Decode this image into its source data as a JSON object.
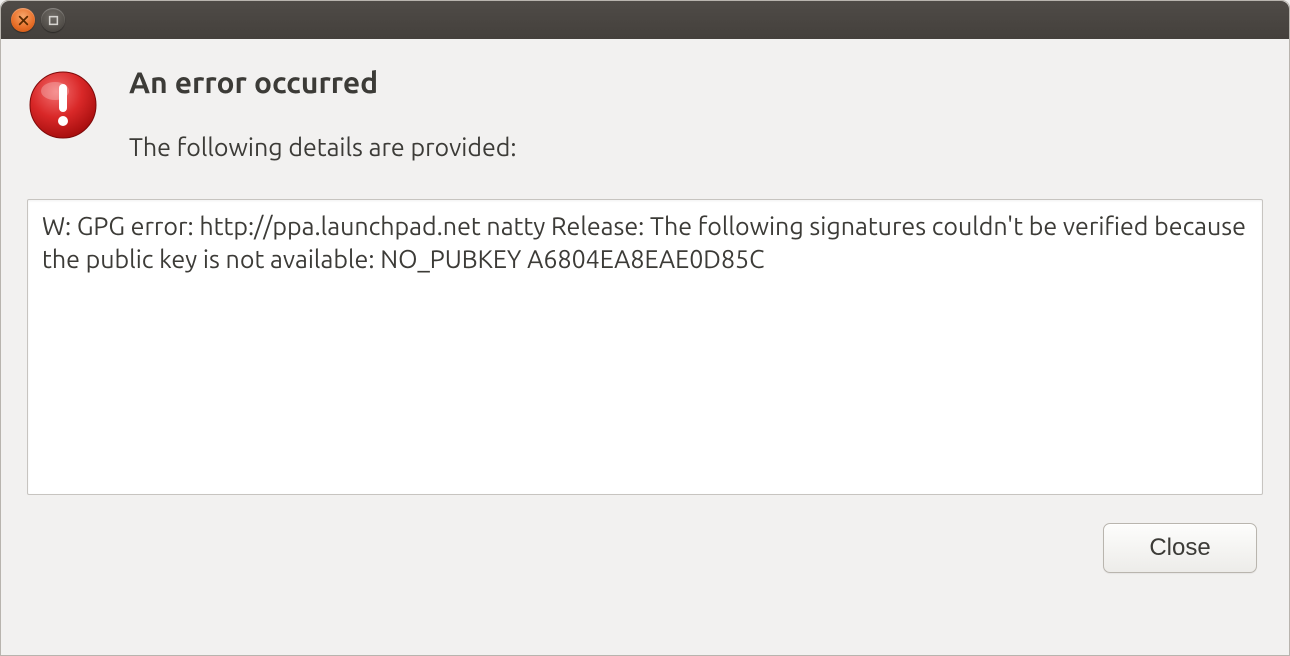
{
  "dialog": {
    "title": "An error occurred",
    "subtitle": "The following details are provided:",
    "details": "W: GPG error: http://ppa.launchpad.net natty Release: The following signatures couldn't be verified because the public key is not available: NO_PUBKEY A6804EA8EAE0D85C",
    "close_label": "Close"
  }
}
